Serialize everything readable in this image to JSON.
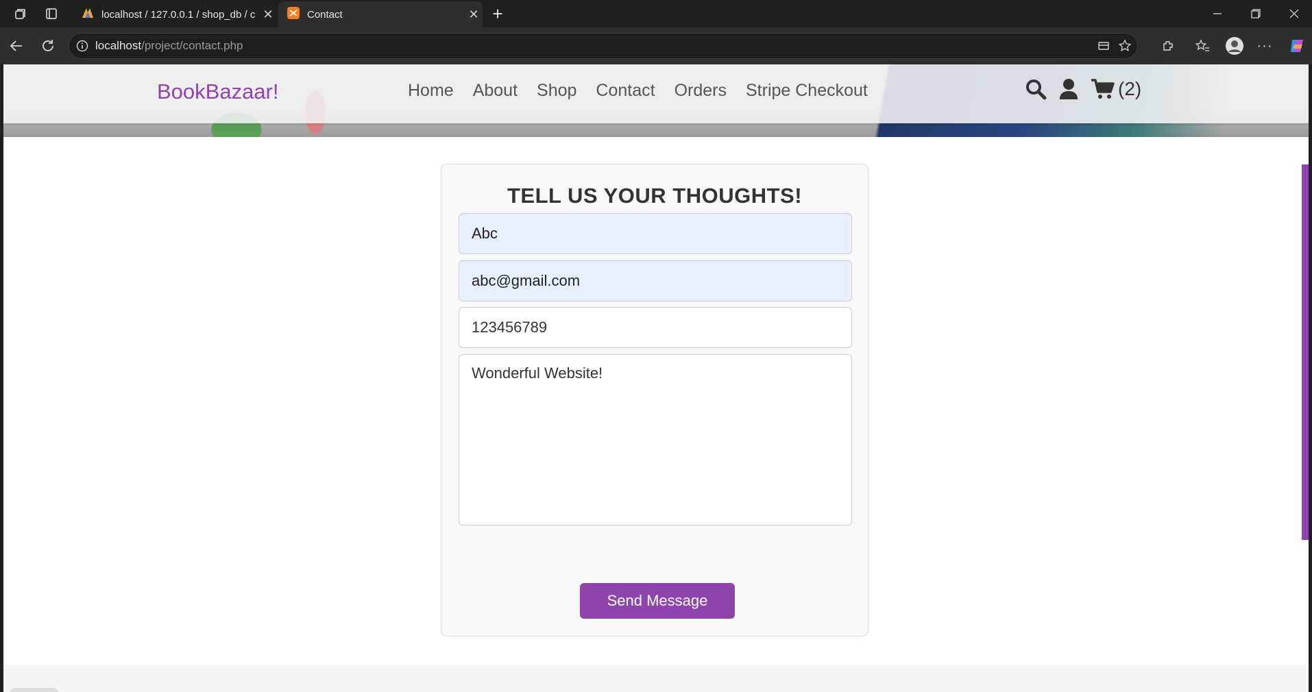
{
  "browser": {
    "tabs": [
      {
        "title": "localhost / 127.0.0.1 / shop_db / c",
        "icon": "phpmyadmin-icon"
      },
      {
        "title": "Contact",
        "icon": "xampp-icon"
      }
    ],
    "url_host": "localhost",
    "url_path": "/project/contact.php"
  },
  "site": {
    "logo": "BookBazaar!",
    "nav": [
      "Home",
      "About",
      "Shop",
      "Contact",
      "Orders",
      "Stripe Checkout"
    ],
    "cart_count": "(2)"
  },
  "form": {
    "title": "TELL US YOUR THOUGHTS!",
    "name": "Abc",
    "email": "abc@gmail.com",
    "number": "123456789",
    "message": "Wonderful Website!",
    "submit": "Send Message"
  },
  "colors": {
    "brand": "#8e44ad",
    "autofill": "#e8f0fe"
  }
}
